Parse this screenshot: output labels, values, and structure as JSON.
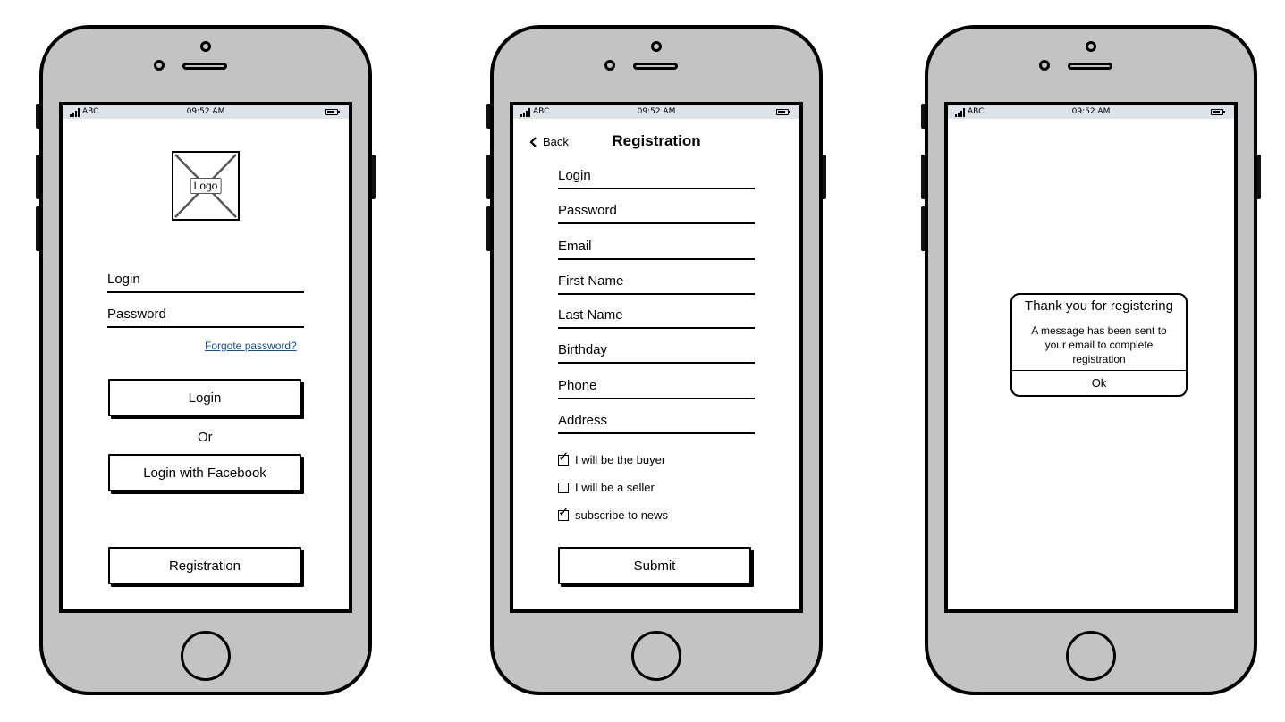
{
  "status_bar": {
    "carrier": "ABC",
    "time": "09:52 AM"
  },
  "login_screen": {
    "logo_label": "Logo",
    "login_label": "Login",
    "password_label": "Password",
    "forgot_password": "Forgote password?",
    "login_button": "Login",
    "or_text": "Or",
    "facebook_button": "Login with Facebook",
    "registration_button": "Registration"
  },
  "registration_screen": {
    "back_label": "Back",
    "title": "Registration",
    "fields": [
      "Login",
      "Password",
      "Email",
      "First Name",
      "Last Name",
      "Birthday",
      "Phone",
      "Address"
    ],
    "checkboxes": [
      {
        "label": "I will be the buyer",
        "checked": true
      },
      {
        "label": "I will be a seller",
        "checked": false
      },
      {
        "label": "subscribe to news",
        "checked": true
      }
    ],
    "submit_button": "Submit"
  },
  "confirmation_screen": {
    "dialog_title": "Thank you for registering",
    "dialog_message": "A message has been sent to your email to complete registration",
    "ok_button": "Ok"
  },
  "colors": {
    "device": "#c3c3c3",
    "status_bar": "#dde3e8",
    "link": "#1a4d8a"
  },
  "icons": [
    "signal-icon",
    "battery-icon",
    "chevron-left-icon",
    "checkbox-icon",
    "image-placeholder-icon"
  ]
}
